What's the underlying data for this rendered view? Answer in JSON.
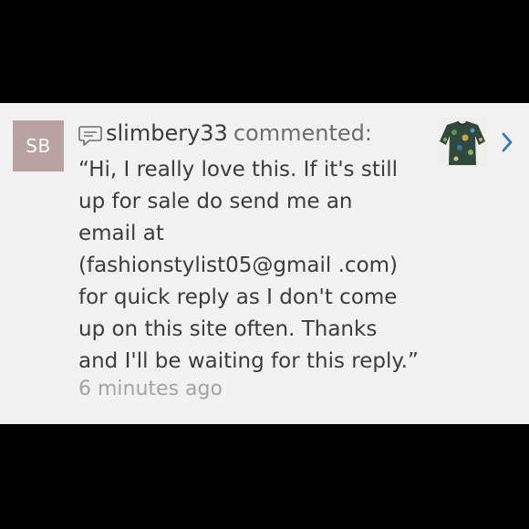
{
  "notification": {
    "avatar_initials": "SB",
    "username": "slimbery33",
    "action": "commented:",
    "comment_lines": [
      "“Hi, I really love this. If it's still",
      "up for sale do send me an",
      "email at",
      "(fashionstylist05@gmail .com)",
      "for quick reply as I don't come",
      "up on this site often. Thanks",
      "and I'll be waiting for this reply.”"
    ],
    "timestamp": "6 minutes ago"
  },
  "icons": {
    "comment": "speech-bubble-icon",
    "chevron": "chevron-right-icon"
  },
  "colors": {
    "card_background": "#f2f2f2",
    "avatar_background": "#b9a29f",
    "chevron": "#2b79c2",
    "text": "#3c3c3c",
    "timestamp": "#a4a4a4"
  }
}
